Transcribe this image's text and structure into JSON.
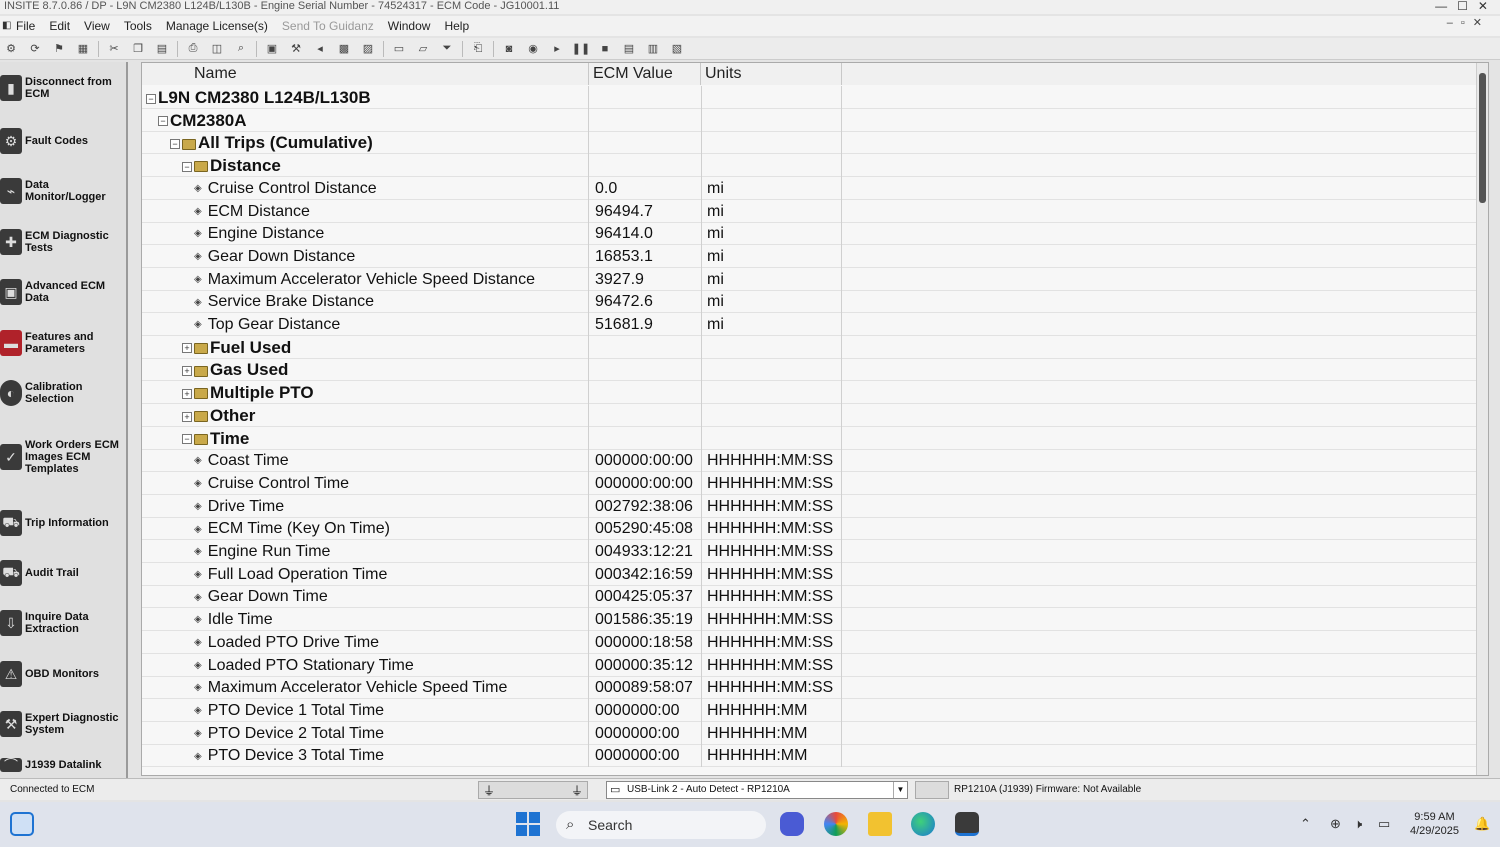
{
  "window": {
    "title": "INSITE 8.7.0.86  / DP - L9N CM2380 L124B/L130B - Engine Serial Number - 74524317 - ECM Code - JG10001.11"
  },
  "menu": {
    "items": [
      "File",
      "Edit",
      "View",
      "Tools",
      "Manage License(s)",
      "Send To Guidanz",
      "Window",
      "Help"
    ]
  },
  "sidebar": {
    "items": [
      {
        "label": "Disconnect from ECM",
        "icon": "disconnect-icon"
      },
      {
        "label": "Fault Codes",
        "icon": "fault-codes-icon"
      },
      {
        "label": "Data Monitor/Logger",
        "icon": "data-monitor-icon"
      },
      {
        "label": "ECM Diagnostic Tests",
        "icon": "diagnostic-tests-icon"
      },
      {
        "label": "Advanced ECM Data",
        "icon": "advanced-ecm-icon"
      },
      {
        "label": "Features and Parameters",
        "icon": "features-parameters-icon"
      },
      {
        "label": "Calibration Selection",
        "icon": "calibration-icon"
      },
      {
        "label": "Work Orders ECM Images ECM Templates",
        "icon": "work-orders-icon"
      },
      {
        "label": "Trip Information",
        "icon": "trip-information-icon"
      },
      {
        "label": "Audit Trail",
        "icon": "audit-trail-icon"
      },
      {
        "label": "Inquire Data Extraction",
        "icon": "inquire-data-icon"
      },
      {
        "label": "OBD Monitors",
        "icon": "obd-monitors-icon"
      },
      {
        "label": "Expert Diagnostic System",
        "icon": "expert-diagnostic-icon"
      },
      {
        "label": "J1939 Datalink",
        "icon": "datalink-icon"
      }
    ]
  },
  "grid": {
    "headers": {
      "name": "Name",
      "value": "ECM Value",
      "units": "Units"
    },
    "rows": [
      {
        "name": "L9N CM2380 L124B/L130B",
        "value": "",
        "units": "",
        "level": 0,
        "kind": "root",
        "expander": "⊟"
      },
      {
        "name": "CM2380A",
        "value": "",
        "units": "",
        "level": 1,
        "kind": "group",
        "expander": "⊟"
      },
      {
        "name": "All Trips (Cumulative)",
        "value": "",
        "units": "",
        "level": 2,
        "kind": "folder",
        "expander": "⊟"
      },
      {
        "name": "Distance",
        "value": "",
        "units": "",
        "level": 3,
        "kind": "folder",
        "expander": "⊟"
      },
      {
        "name": "Cruise Control Distance",
        "value": "0.0",
        "units": "mi",
        "level": 4,
        "kind": "param"
      },
      {
        "name": "ECM  Distance",
        "value": "96494.7",
        "units": "mi",
        "level": 4,
        "kind": "param"
      },
      {
        "name": "Engine  Distance",
        "value": "96414.0",
        "units": "mi",
        "level": 4,
        "kind": "param"
      },
      {
        "name": "Gear Down Distance",
        "value": "16853.1",
        "units": "mi",
        "level": 4,
        "kind": "param"
      },
      {
        "name": "Maximum Accelerator Vehicle Speed Distance",
        "value": "3927.9",
        "units": "mi",
        "level": 4,
        "kind": "param"
      },
      {
        "name": "Service Brake Distance",
        "value": "96472.6",
        "units": "mi",
        "level": 4,
        "kind": "param"
      },
      {
        "name": "Top Gear Distance",
        "value": "51681.9",
        "units": "mi",
        "level": 4,
        "kind": "param"
      },
      {
        "name": "Fuel  Used",
        "value": "",
        "units": "",
        "level": 3,
        "kind": "folder",
        "expander": "⊞"
      },
      {
        "name": "Gas Used",
        "value": "",
        "units": "",
        "level": 3,
        "kind": "folder",
        "expander": "⊞"
      },
      {
        "name": "Multiple PTO",
        "value": "",
        "units": "",
        "level": 3,
        "kind": "folder",
        "expander": "⊞"
      },
      {
        "name": "Other",
        "value": "",
        "units": "",
        "level": 3,
        "kind": "folder",
        "expander": "⊞"
      },
      {
        "name": "Time",
        "value": "",
        "units": "",
        "level": 3,
        "kind": "folder",
        "expander": "⊟"
      },
      {
        "name": "Coast Time",
        "value": "000000:00:00",
        "units": "HHHHHH:MM:SS",
        "level": 4,
        "kind": "param"
      },
      {
        "name": "Cruise Control Time",
        "value": "000000:00:00",
        "units": "HHHHHH:MM:SS",
        "level": 4,
        "kind": "param"
      },
      {
        "name": "Drive Time",
        "value": "002792:38:06",
        "units": "HHHHHH:MM:SS",
        "level": 4,
        "kind": "param"
      },
      {
        "name": "ECM Time (Key On Time)",
        "value": "005290:45:08",
        "units": "HHHHHH:MM:SS",
        "level": 4,
        "kind": "param"
      },
      {
        "name": "Engine Run Time",
        "value": "004933:12:21",
        "units": "HHHHHH:MM:SS",
        "level": 4,
        "kind": "param"
      },
      {
        "name": "Full Load Operation Time",
        "value": "000342:16:59",
        "units": "HHHHHH:MM:SS",
        "level": 4,
        "kind": "param"
      },
      {
        "name": "Gear Down Time",
        "value": "000425:05:37",
        "units": "HHHHHH:MM:SS",
        "level": 4,
        "kind": "param"
      },
      {
        "name": "Idle Time",
        "value": "001586:35:19",
        "units": "HHHHHH:MM:SS",
        "level": 4,
        "kind": "param"
      },
      {
        "name": "Loaded PTO Drive Time",
        "value": "000000:18:58",
        "units": "HHHHHH:MM:SS",
        "level": 4,
        "kind": "param"
      },
      {
        "name": "Loaded PTO Stationary Time",
        "value": "000000:35:12",
        "units": "HHHHHH:MM:SS",
        "level": 4,
        "kind": "param"
      },
      {
        "name": "Maximum Accelerator Vehicle Speed Time",
        "value": "000089:58:07",
        "units": "HHHHHH:MM:SS",
        "level": 4,
        "kind": "param"
      },
      {
        "name": "PTO Device 1 Total Time",
        "value": "0000000:00",
        "units": "HHHHHH:MM",
        "level": 4,
        "kind": "param"
      },
      {
        "name": "PTO Device 2 Total Time",
        "value": "0000000:00",
        "units": "HHHHHH:MM",
        "level": 4,
        "kind": "param"
      },
      {
        "name": "PTO Device 3 Total Time",
        "value": "0000000:00",
        "units": "HHHHHH:MM",
        "level": 4,
        "kind": "param"
      }
    ]
  },
  "status": {
    "connection": "Connected to ECM",
    "adapter": "USB-Link 2 - Auto Detect - RP1210A",
    "protocol": "RP1210A (J1939)  Firmware: Not Available"
  },
  "taskbar": {
    "search_placeholder": "Search",
    "time": "9:59 AM",
    "date": "4/29/2025"
  },
  "colors": {
    "accent_blue": "#1e73d2",
    "ecm_red": "#b0222a",
    "folder": "#c9a94a"
  }
}
